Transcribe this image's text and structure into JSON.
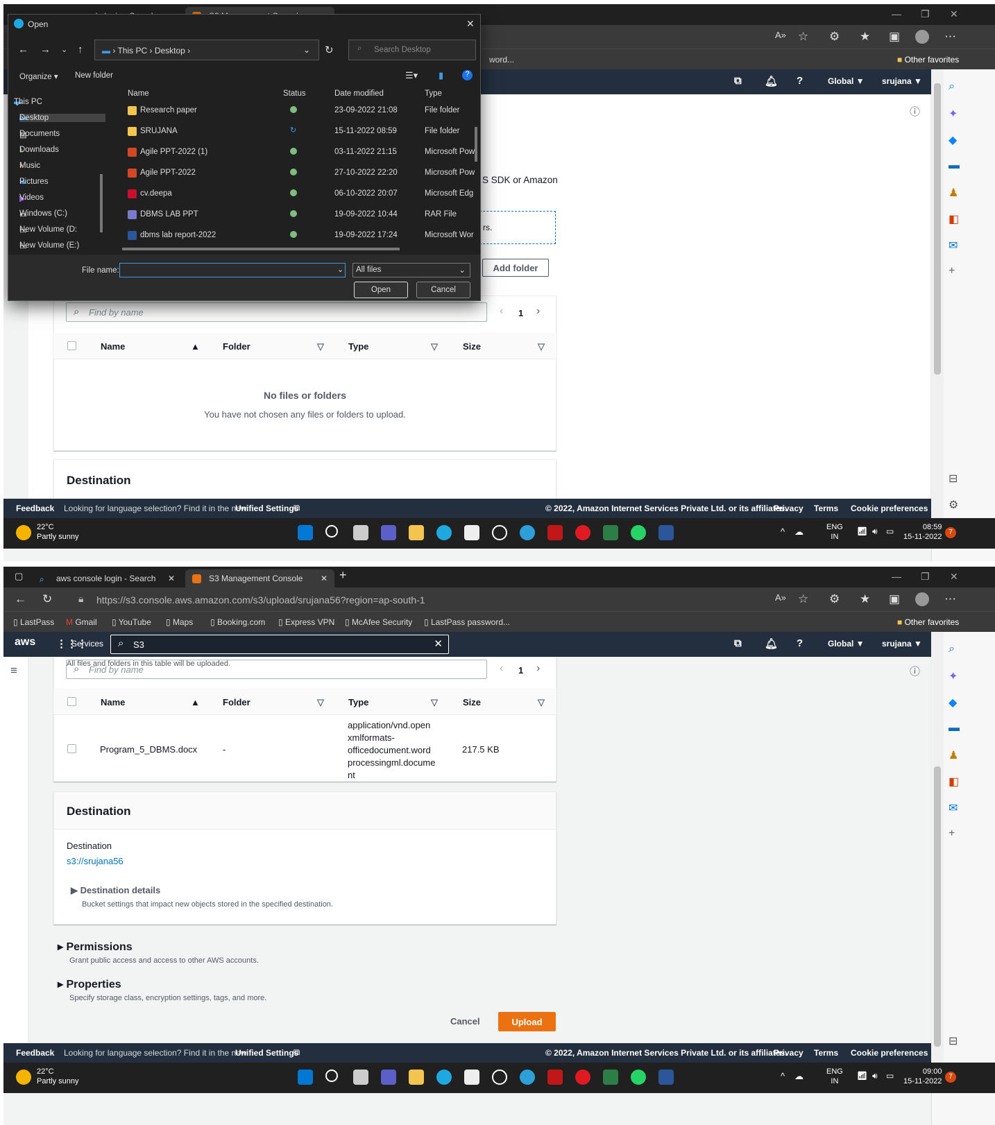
{
  "browser": {
    "tab1": "aws console login - Search",
    "tab2": "S3 Management Console",
    "url": "https://s3.console.aws.amazon.com/s3/upload/srujana56?region=ap-south-1",
    "bookmarks": [
      "LastPass",
      "Gmail",
      "YouTube",
      "Maps",
      "Booking.com",
      "Express VPN",
      "McAfee Security",
      "LastPass password..."
    ],
    "bookmark_partial": "word...",
    "other_favorites": "Other favorites"
  },
  "aws": {
    "logo": "aws",
    "services": "Services",
    "search_value": "S3",
    "region": "Global ▼",
    "user": "srujana ▼"
  },
  "upload": {
    "partial_text1": "S SDK or Amazon",
    "partial_text2": "rs.",
    "add_folder": "Add folder",
    "table_note": "All files and folders in this table will be uploaded.",
    "find_placeholder": "Find by name",
    "page": "1",
    "columns": [
      "Name",
      "Folder",
      "Type",
      "Size"
    ],
    "empty_title": "No files or folders",
    "empty_desc": "You have not chosen any files or folders to upload.",
    "file": {
      "name": "Program_5_DBMS.docx",
      "folder": "-",
      "type_lines": [
        "application/vnd.open",
        "xmlformats-",
        "officedocument.word",
        "processingml.docume",
        "nt"
      ],
      "size": "217.5 KB"
    },
    "destination_title": "Destination",
    "destination_label": "Destination",
    "destination_link": "s3://srujana56",
    "dest_details": "Destination details",
    "dest_details_desc": "Bucket settings that impact new objects stored in the specified destination.",
    "permissions": "Permissions",
    "permissions_desc": "Grant public access and access to other AWS accounts.",
    "properties": "Properties",
    "properties_desc": "Specify storage class, encryption settings, tags, and more.",
    "cancel": "Cancel",
    "upload": "Upload"
  },
  "footer": {
    "feedback": "Feedback",
    "lang_msg": "Looking for language selection? Find it in the new",
    "unified": "Unified Settings",
    "copyright": "© 2022, Amazon Internet Services Private Ltd. or its affiliates.",
    "privacy": "Privacy",
    "terms": "Terms",
    "cookies": "Cookie preferences"
  },
  "taskbar": {
    "temp": "22°C",
    "weather": "Partly sunny",
    "lang1": "ENG",
    "lang2": "IN",
    "time1": "08:59",
    "time2": "09:00",
    "date": "15-11-2022",
    "notif": "7"
  },
  "dialog": {
    "title": "Open",
    "path": [
      "This PC",
      "Desktop"
    ],
    "search_placeholder": "Search Desktop",
    "organize": "Organize ▾",
    "new_folder": "New folder",
    "columns": [
      "Name",
      "Status",
      "Date modified",
      "Type"
    ],
    "tree": [
      "This PC",
      "Desktop",
      "Documents",
      "Downloads",
      "Music",
      "Pictures",
      "Videos",
      "Windows (C:)",
      "New Volume (D:",
      "New Volume (E:)"
    ],
    "files": [
      {
        "name": "Research paper",
        "date": "23-09-2022 21:08",
        "type": "File folder"
      },
      {
        "name": "SRUJANA",
        "date": "15-11-2022 08:59",
        "type": "File folder"
      },
      {
        "name": "Agile PPT-2022 (1)",
        "date": "03-11-2022 21:15",
        "type": "Microsoft Pow"
      },
      {
        "name": "Agile PPT-2022",
        "date": "27-10-2022 22:20",
        "type": "Microsoft Pow"
      },
      {
        "name": "cv.deepa",
        "date": "06-10-2022 20:07",
        "type": "Microsoft Edg"
      },
      {
        "name": "DBMS LAB PPT",
        "date": "19-09-2022 10:44",
        "type": "RAR File"
      },
      {
        "name": "dbms lab report-2022",
        "date": "19-09-2022 17:24",
        "type": "Microsoft Wor"
      }
    ],
    "file_name_label": "File name:",
    "file_name_value": "",
    "filter": "All files",
    "open": "Open",
    "cancel": "Cancel"
  },
  "colors": {
    "aws_nav": "#232f3e",
    "upload_orange": "#ec7211",
    "link": "#0073bb",
    "dark": "#202020"
  }
}
